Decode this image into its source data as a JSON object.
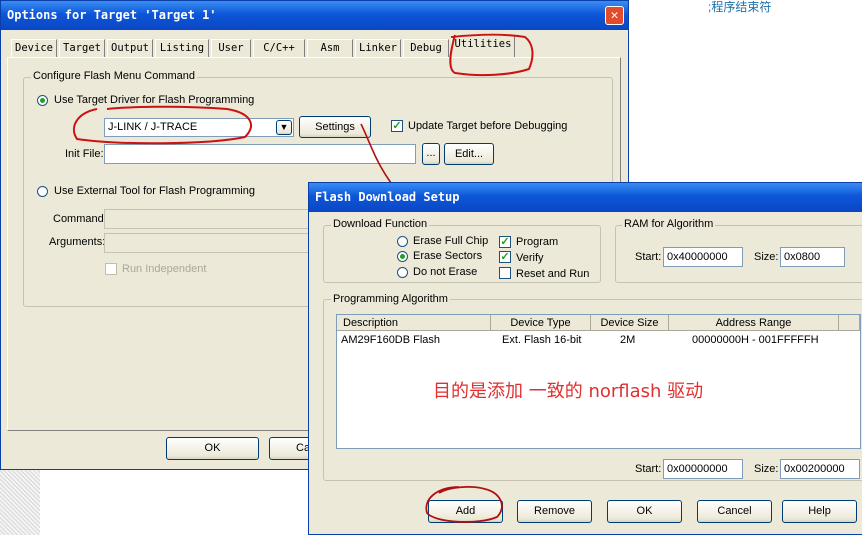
{
  "note_text": ";程序结束符",
  "options_dialog": {
    "title": "Options for Target 'Target 1'",
    "tabs": [
      "Device",
      "Target",
      "Output",
      "Listing",
      "User",
      "C/C++",
      "Asm",
      "Linker",
      "Debug",
      "Utilities"
    ],
    "group_label": "Configure Flash Menu Command",
    "use_target_driver": "Use Target Driver for Flash Programming",
    "driver_selected": "J-LINK / J-TRACE",
    "settings_label": "Settings",
    "update_target_label": "Update Target before Debugging",
    "init_file_label": "Init File:",
    "init_file_value": "",
    "browse_label": "...",
    "edit_label": "Edit...",
    "use_external_tool": "Use External Tool for Flash Programming",
    "command_label": "Command:",
    "arguments_label": "Arguments:",
    "run_independent": "Run Independent",
    "ok_label": "OK",
    "cancel_label": "Ca"
  },
  "flash_dialog": {
    "title": "Flash Download Setup",
    "download_function": {
      "label": "Download Function",
      "erase_full_chip": "Erase Full Chip",
      "erase_sectors": "Erase Sectors",
      "do_not_erase": "Do not Erase",
      "program": "Program",
      "verify": "Verify",
      "reset_and_run": "Reset and Run"
    },
    "ram": {
      "label": "RAM for Algorithm",
      "start_label": "Start:",
      "start_value": "0x40000000",
      "size_label": "Size:",
      "size_value": "0x0800"
    },
    "algorithm": {
      "label": "Programming Algorithm",
      "columns": [
        "Description",
        "Device Type",
        "Device Size",
        "Address Range"
      ],
      "rows": [
        [
          "AM29F160DB Flash",
          "Ext. Flash 16-bit",
          "2M",
          "00000000H - 001FFFFFH"
        ]
      ],
      "start_label": "Start:",
      "start_value": "0x00000000",
      "size_label": "Size:",
      "size_value": "0x00200000"
    },
    "buttons": {
      "add": "Add",
      "remove": "Remove",
      "ok": "OK",
      "cancel": "Cancel",
      "help": "Help"
    },
    "annotation": "目的是添加 一致的 norflash 驱动"
  },
  "colors": {
    "annotation_red": "#e03030",
    "title_blue": "#0a46c4",
    "dialog_face": "#ece9d8"
  }
}
